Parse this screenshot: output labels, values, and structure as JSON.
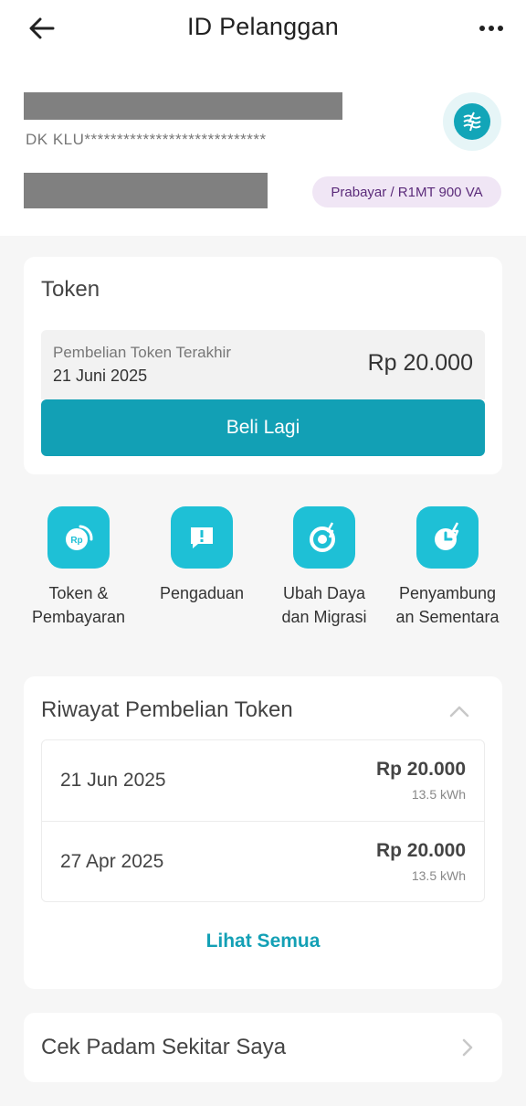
{
  "header": {
    "title": "ID Pelanggan",
    "back_icon": "arrow-left-icon",
    "more_icon": "more-horizontal-icon"
  },
  "customer": {
    "masked_id": "DK KLU****************************",
    "tariff_badge": "Prabayar / R1MT 900 VA",
    "logo_icon": "pln-logo-icon"
  },
  "token": {
    "title": "Token",
    "last_purchase_label": "Pembelian Token Terakhir",
    "last_purchase_date": "21 Juni 2025",
    "last_purchase_amount": "Rp 20.000",
    "buy_again_label": "Beli Lagi"
  },
  "menu": [
    {
      "label": "Token &\nPembayaran",
      "icon": "rp-coin-icon"
    },
    {
      "label": "Pengaduan",
      "icon": "complaint-chat-icon"
    },
    {
      "label": "Ubah Daya\ndan Migrasi",
      "icon": "power-change-icon"
    },
    {
      "label": "Penyambung\nan Sementara",
      "icon": "temporary-connection-icon"
    }
  ],
  "history": {
    "title": "Riwayat Pembelian Token",
    "rows": [
      {
        "date": "21 Jun 2025",
        "amount": "Rp 20.000",
        "kwh": "13.5 kWh"
      },
      {
        "date": "27 Apr 2025",
        "amount": "Rp 20.000",
        "kwh": "13.5 kWh"
      }
    ],
    "see_all_label": "Lihat Semua"
  },
  "outage": {
    "label": "Cek Padam Sekitar Saya"
  },
  "colors": {
    "accent": "#12a0b5",
    "icon_bg": "#1ec0d6",
    "badge_bg": "#f0e6f5",
    "badge_text": "#5b2b7a"
  }
}
